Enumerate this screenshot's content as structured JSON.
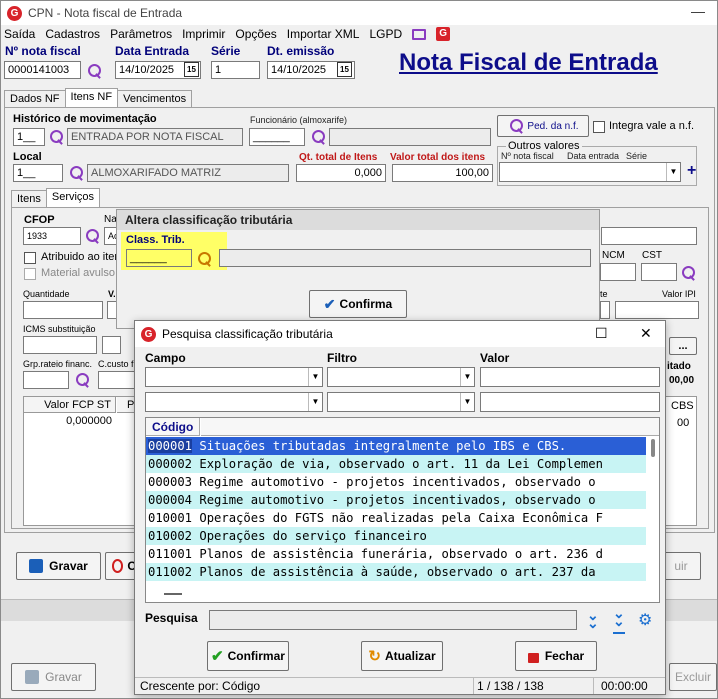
{
  "app": {
    "title": "CPN - Nota fiscal de Entrada",
    "minimize": "—",
    "heading": "Nota Fiscal de Entrada"
  },
  "menu": [
    "Saída",
    "Cadastros",
    "Parâmetros",
    "Imprimir",
    "Opções",
    "Importar XML",
    "LGPD"
  ],
  "header": {
    "nf_label": "Nº nota fiscal",
    "nf_value": "0000141003",
    "data_entrada_label": "Data Entrada",
    "data_entrada_value": "14/10/2025",
    "serie_label": "Série",
    "serie_value": "1",
    "dt_emissao_label": "Dt. emissão",
    "dt_emissao_value": "14/10/2025",
    "cal_glyph": "15"
  },
  "tabs": [
    "Dados NF",
    "Itens NF",
    "Vencimentos"
  ],
  "itens": {
    "historico_label": "Histórico de movimentação",
    "historico_code": "1__",
    "historico_desc": "ENTRADA POR NOTA FISCAL",
    "funcionario_label": "Funcionário (almoxarife)",
    "funcionario_value": "______",
    "ped_label": "Ped. da n.f.",
    "integra_label": "Integra vale a n.f.",
    "local_label": "Local",
    "local_code": "1__",
    "local_desc": "ALMOXARIFADO MATRIZ",
    "qt_label": "Qt. total de Itens",
    "qt_value": "0,000",
    "valor_label": "Valor total dos itens",
    "valor_value": "100,00",
    "outros_label": "Outros valores",
    "outros_cols": [
      "Nº nota fiscal",
      "Data entrada",
      "Série"
    ],
    "plus": "+"
  },
  "subtabs": [
    "Itens",
    "Serviços"
  ],
  "servicos": {
    "cfop_label": "CFOP",
    "cfop_value": "1933",
    "na_label": "Na",
    "ac_value": "Ac",
    "atribuido_label": "Atribuido ao iten",
    "material_label": "Material avulso",
    "ncm_label": "NCM",
    "cst_label": "CST",
    "quantidade_label": "Quantidade",
    "v_label": "V.",
    "te_label": "te",
    "valor_ipi_label": "Valor IPI",
    "icms_label": "ICMS substituição",
    "grp_label": "Grp.rateio financ.",
    "ccusto_label": "C.custo f",
    "dots": "...",
    "itado_label": "itado",
    "itado_value": "00,00",
    "grid_cols": [
      "Valor FCP ST",
      "P",
      "CBS"
    ],
    "fcp_value": "0,000000",
    "cbs_value": "00",
    "gravar": "Gravar",
    "c_label": "C",
    "uir": "uir"
  },
  "class_dialog": {
    "title": "Altera classificação tributária",
    "field_label": "Class. Trib.",
    "field_value": "______",
    "confirm": "Confirma"
  },
  "pesquisa": {
    "title": "Pesquisa classificação tributária",
    "maximize": "☐",
    "close": "✕",
    "campo_label": "Campo",
    "filtro_label": "Filtro",
    "valor_label": "Valor",
    "dd_arrow": "▼",
    "grid_header": "Código",
    "rows": [
      {
        "code": "000001",
        "desc": "Situações tributadas integralmente pelo IBS e CBS."
      },
      {
        "code": "000002",
        "desc": "Exploração de via, observado o art. 11 da Lei Complemen"
      },
      {
        "code": "000003",
        "desc": "Regime automotivo - projetos incentivados, observado o"
      },
      {
        "code": "000004",
        "desc": "Regime automotivo - projetos incentivados, observado o"
      },
      {
        "code": "010001",
        "desc": "Operações do FGTS não realizadas pela Caixa Econômica F"
      },
      {
        "code": "010002",
        "desc": "Operações do serviço financeiro"
      },
      {
        "code": "011001",
        "desc": "Planos de assistência funerária, observado o art. 236 d"
      },
      {
        "code": "011002",
        "desc": "Planos de assistência à saúde, observado o art. 237 da"
      }
    ],
    "search_label": "Pesquisa",
    "confirm": "Confirmar",
    "refresh": "Atualizar",
    "close_btn": "Fechar",
    "status_order": "Crescente por: Código",
    "status_count": "1 / 138 / 138",
    "status_time": "00:00:00"
  },
  "bottom": {
    "gravar": "Gravar",
    "excluir": "Excluir"
  },
  "colors": {
    "accent": "#0d0d8a",
    "selection": "#2a5fd6",
    "highlight": "#ffff66",
    "row_alt": "#c8f4f4",
    "confirm_green": "#22a022",
    "close_red": "#d02020"
  }
}
